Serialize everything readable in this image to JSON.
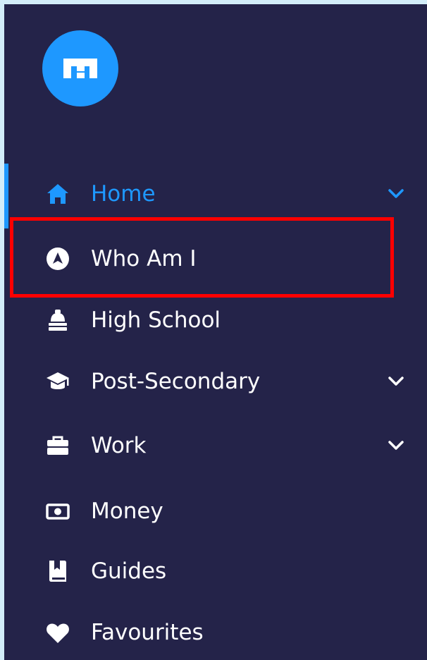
{
  "sidebar": {
    "logo": {
      "icon": "m-logo-icon",
      "color": "#1e98ff"
    },
    "accent_color": "#1e98ff",
    "background_color": "#242349",
    "items": [
      {
        "label": "Home",
        "icon": "home-icon",
        "active": true,
        "expandable": true
      },
      {
        "label": "Who Am I",
        "icon": "compass-icon",
        "active": false,
        "expandable": false,
        "highlighted": true
      },
      {
        "label": "High School",
        "icon": "school-bell-icon",
        "active": false,
        "expandable": false
      },
      {
        "label": "Post-Secondary",
        "icon": "graduation-cap-icon",
        "active": false,
        "expandable": true
      },
      {
        "label": "Work",
        "icon": "briefcase-icon",
        "active": false,
        "expandable": true
      },
      {
        "label": "Money",
        "icon": "money-icon",
        "active": false,
        "expandable": false
      },
      {
        "label": "Guides",
        "icon": "book-icon",
        "active": false,
        "expandable": false
      },
      {
        "label": "Favourites",
        "icon": "heart-icon",
        "active": false,
        "expandable": false
      }
    ]
  },
  "annotation": {
    "highlight_color": "#ff0000"
  }
}
